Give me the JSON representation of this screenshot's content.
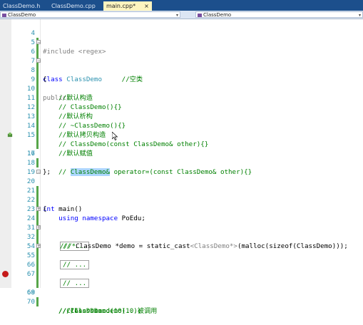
{
  "tabs": [
    {
      "label": "ClassDemo.h",
      "active": false
    },
    {
      "label": "ClassDemo.cpp",
      "active": false
    },
    {
      "label": "main.cpp*",
      "active": true,
      "close": "×"
    }
  ],
  "navigation": {
    "left_scope": "ClassDemo",
    "right_scope": "ClassDemo"
  },
  "editor": {
    "lines": [
      {
        "num": "4",
        "text": "#include <regex>"
      },
      {
        "num": "5",
        "text": ""
      },
      {
        "num": "6",
        "text_a": "class ",
        "text_b": "ClassDemo",
        "text_c": "     //空类"
      },
      {
        "num": "7",
        "text": "{"
      },
      {
        "num": "8",
        "text": "public:"
      },
      {
        "num": "9",
        "text": "    //默认构造"
      },
      {
        "num": "10",
        "text": "    // ClassDemo(){}"
      },
      {
        "num": "11",
        "text": "    //默认析构"
      },
      {
        "num": "12",
        "text": "    // ~ClassDemo(){}"
      },
      {
        "num": "13",
        "text": "    //默认拷贝构造"
      },
      {
        "num": "14",
        "text": "    // ClassDemo(const ClassDemo& other){}"
      },
      {
        "num": "15",
        "text": "    //默认赋值"
      },
      {
        "num": "16",
        "text_a": "    // ",
        "text_sel": "ClassDemo&",
        "text_c": " operator=(const ClassDemo& other){}"
      },
      {
        "num": "17",
        "text": "};"
      },
      {
        "num": "18",
        "text": ""
      },
      {
        "num": "19",
        "text": ""
      },
      {
        "num": "20",
        "text_a": "int",
        "text_b": " main()"
      },
      {
        "num": "21",
        "text": "{"
      },
      {
        "num": "22",
        "text_a": "    ",
        "text_b": "using namespace",
        "text_c": " PoEdu;"
      },
      {
        "num": "23",
        "text": ""
      },
      {
        "num": "24",
        "text": "// ..."
      },
      {
        "num": "31",
        "text_a": "///*",
        "text_b": "ClassDemo *demo = static_cast",
        "text_c": "<ClassDemo*>",
        "text_d": "(malloc(sizeof(ClassDemo)));"
      },
      {
        "num": "32",
        "text": "// ..."
      },
      {
        "num": "54",
        "text": ""
      },
      {
        "num": "55",
        "text": "// ..."
      },
      {
        "num": "66",
        "text": ""
      },
      {
        "num": "67",
        "text": ""
      },
      {
        "num": "68",
        "text": "    //ClassDemo demo(10);"
      },
      {
        "num": "69",
        "text": "    ////ClassDemo(10)...被调用"
      },
      {
        "num": "70",
        "text": "    ///ClassDemo..."
      }
    ]
  },
  "colors": {
    "tab_bar": "#1c4f8c",
    "active_tab": "#fdf4bf",
    "line_number": "#2b91af",
    "keyword": "#0000ff",
    "comment": "#008000",
    "breakpoint": "#c51a1a"
  },
  "icons": {
    "breakpoint": "breakpoint-icon",
    "bookmark": "change-marker-icon"
  }
}
